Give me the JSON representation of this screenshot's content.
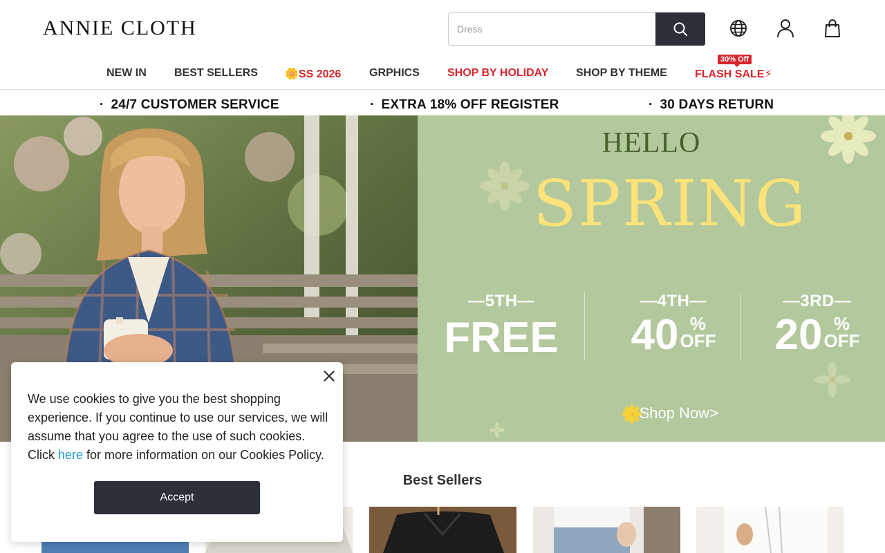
{
  "header": {
    "logo": "ANNIE CLOTH",
    "search_placeholder": "Dress"
  },
  "nav": {
    "items": [
      "NEW IN",
      "BEST SELLERS",
      "🌼SS 2026",
      "GRPHICS",
      "SHOP BY HOLIDAY",
      "SHOP BY THEME",
      "FLASH SALE⚡"
    ],
    "flash_badge": "30% Off"
  },
  "strip": {
    "items": [
      "24/7 CUSTOMER SERVICE",
      "EXTRA 18% OFF REGISTER",
      "30 DAYS RETURN"
    ]
  },
  "hero": {
    "hello": "HELLO",
    "spring": "SPRING",
    "tiers": [
      {
        "label": "—5TH—",
        "value": "FREE",
        "pct": "",
        "off": ""
      },
      {
        "label": "—4TH—",
        "value": "40",
        "pct": "%",
        "off": "OFF"
      },
      {
        "label": "—3RD—",
        "value": "20",
        "pct": "%",
        "off": "OFF"
      }
    ],
    "shop_now": "Shop Now>"
  },
  "best_sellers": {
    "title": "Best Sellers"
  },
  "cookie": {
    "text_before": "We use cookies to give you the best shopping experience. If you continue to use our services, we will assume that you agree to the use of such cookies. Click ",
    "link": "here",
    "text_after": " for more information on our Cookies Policy.",
    "accept": "Accept"
  },
  "colors": {
    "brand_dark": "#2d3038",
    "sale_red": "#d6262d",
    "promo_green": "#b3c89c",
    "spring_yellow": "#fbe37a",
    "link_blue": "#1a9ad6"
  }
}
